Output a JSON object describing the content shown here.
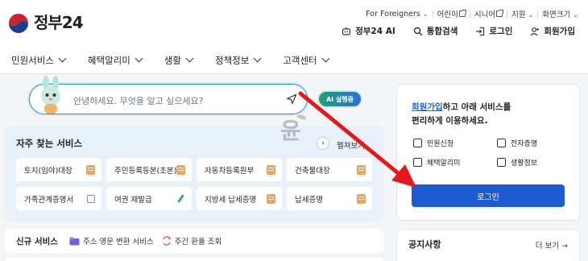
{
  "header": {
    "brand": "정부24",
    "util_links": [
      {
        "label": "For Foreigners",
        "type": "dropdown"
      },
      {
        "label": "어린이",
        "type": "external"
      },
      {
        "label": "시니어",
        "type": "external"
      },
      {
        "label": "지원",
        "type": "dropdown"
      },
      {
        "label": "화면크기",
        "type": "dropdown"
      }
    ],
    "quick": {
      "ai": "정부24 AI",
      "search": "통합검색",
      "login": "로그인",
      "signup": "회원가입"
    }
  },
  "nav": [
    "민원서비스",
    "혜택알리미",
    "생활",
    "정책정보",
    "고객센터"
  ],
  "search": {
    "placeholder": "안녕하세요. 무엇을 알고 싶으세요?",
    "ai_button": "AI 실행중"
  },
  "frequent": {
    "title": "자주 찾는 서비스",
    "expand": "펼쳐보기",
    "services": [
      {
        "label": "토지(임야)대장",
        "icon": "doc"
      },
      {
        "label": "주민등록등본(초본)",
        "icon": "doc"
      },
      {
        "label": "자동차등록원부",
        "icon": "doc"
      },
      {
        "label": "건축물대장",
        "icon": "doc"
      },
      {
        "label": "가족관계증명서",
        "icon": "link"
      },
      {
        "label": "여권 재발급",
        "icon": "pen"
      },
      {
        "label": "지방세 납세증명",
        "icon": "doc"
      },
      {
        "label": "납세증명",
        "icon": "doc"
      }
    ]
  },
  "new_services": {
    "title": "신규 서비스",
    "items": [
      "주소 영문 변환 서비스",
      "주간 환율 조회"
    ]
  },
  "login_card": {
    "message_link": "회원가입",
    "message_rest_1": "하고 아래 서비스를",
    "message_line_2": "편리하게 이용하세요.",
    "items": [
      "민원신청",
      "전자증명",
      "혜택알리미",
      "생활정보"
    ],
    "button": "로그인"
  },
  "notice": {
    "title": "공지사항",
    "more": "더 보기 →"
  },
  "watermark": "윤",
  "colors": {
    "primary": "#1b5cd3",
    "arrow": "#e8171b",
    "freq_bg": "#e8f1fa",
    "search_border": "#2a8fbd"
  }
}
